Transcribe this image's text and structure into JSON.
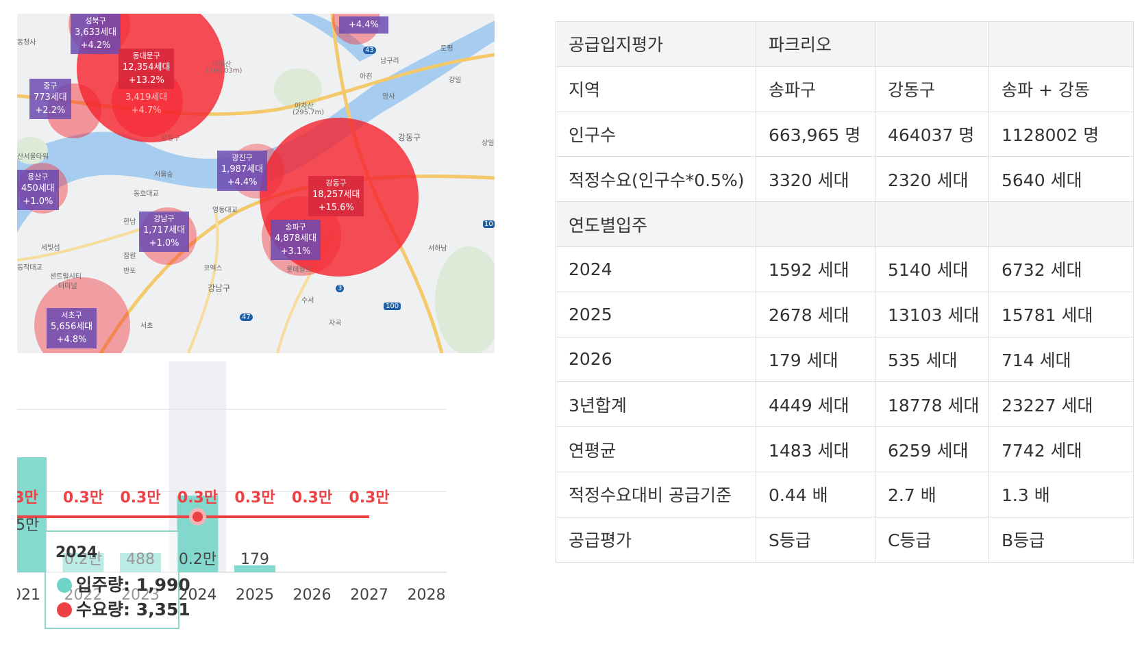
{
  "map": {
    "districts": [
      {
        "name": "성북구",
        "households": "3,633세대",
        "change": "+4.2%"
      },
      {
        "name": "동대문구",
        "households": "12,354세대",
        "change": "+13.2%"
      },
      {
        "name": "",
        "households": "3,419세대",
        "change": "+4.7%"
      },
      {
        "name": "중구",
        "households": "773세대",
        "change": "+2.2%"
      },
      {
        "name": "광진구",
        "households": "1,987세대",
        "change": "+4.4%"
      },
      {
        "name": "강동구",
        "households": "18,257세대",
        "change": "+15.6%"
      },
      {
        "name": "용산구",
        "households": "450세대",
        "change": "+1.0%"
      },
      {
        "name": "강남구",
        "households": "1,717세대",
        "change": "+1.0%"
      },
      {
        "name": "송파구",
        "households": "4,878세대",
        "change": "+3.1%"
      },
      {
        "name": "서초구",
        "households": "5,656세대",
        "change": "+4.8%"
      },
      {
        "name": "",
        "households": "",
        "change": "+4.4%"
      }
    ],
    "place_labels": [
      "동청사",
      "남구리",
      "토평",
      "아천",
      "강일",
      "암사",
      "아차산",
      "(295.7m)",
      "강동구",
      "상일",
      "산서울타워",
      "서울숲",
      "동호대교",
      "영동대교",
      "한남",
      "잠원",
      "세빛섬",
      "반포",
      "코엑스",
      "롯데월드",
      "서하남",
      "강남구",
      "센트럴시티",
      "터미널",
      "수서",
      "서초",
      "자곡",
      "성동구",
      "배봉산",
      "(106.03m)",
      "동작대교",
      "43",
      "47",
      "3",
      "100",
      "10"
    ]
  },
  "chart": {
    "years": [
      "021",
      "2022",
      "2023",
      "2024",
      "2025",
      "2026",
      "2027",
      "2028"
    ],
    "demand_labels": [
      "3만",
      "0.3만",
      "0.3만",
      "0.3만",
      "0.3만",
      "0.3만",
      "0.3만"
    ],
    "left_partial_label": "5만",
    "supply_labels": [
      "0.2만",
      "488",
      "0.2만",
      "179"
    ],
    "supply_values": [
      0.3,
      0.05,
      0.05,
      0.2,
      0.0179
    ],
    "demand_value": 0.3,
    "tooltip": {
      "year": "2024",
      "supply": "입주량: 1,990",
      "demand": "수요량: 3,351"
    },
    "colors": {
      "supply": "#6fd3c5",
      "demand": "#ec4246",
      "highlight": "#eef0f5"
    }
  },
  "table": {
    "rows": [
      {
        "cells": [
          "공급입지평가",
          "파크리오",
          "",
          ""
        ],
        "gray": true
      },
      {
        "cells": [
          "지역",
          "송파구",
          "강동구",
          "송파 + 강동"
        ]
      },
      {
        "cells": [
          "인구수",
          "663,965 명",
          "464037 명",
          "1128002 명"
        ]
      },
      {
        "cells": [
          "적정수요(인구수*0.5%)",
          "3320 세대",
          "2320 세대",
          "5640 세대"
        ]
      },
      {
        "cells": [
          "연도별입주",
          "",
          "",
          ""
        ],
        "gray": true
      },
      {
        "cells": [
          "2024",
          "1592 세대",
          "5140 세대",
          "6732 세대"
        ]
      },
      {
        "cells": [
          "2025",
          "2678 세대",
          "13103 세대",
          "15781 세대"
        ]
      },
      {
        "cells": [
          "2026",
          "179 세대",
          "535 세대",
          "714 세대"
        ]
      },
      {
        "cells": [
          "3년합계",
          "4449 세대",
          "18778 세대",
          "23227 세대"
        ]
      },
      {
        "cells": [
          "연평균",
          "1483 세대",
          "6259 세대",
          "7742 세대"
        ]
      },
      {
        "cells": [
          "적정수요대비 공급기준",
          "0.44 배",
          "2.7 배",
          "1.3 배"
        ]
      },
      {
        "cells": [
          "공급평가",
          "S등급",
          "C등급",
          "B등급"
        ]
      }
    ]
  }
}
